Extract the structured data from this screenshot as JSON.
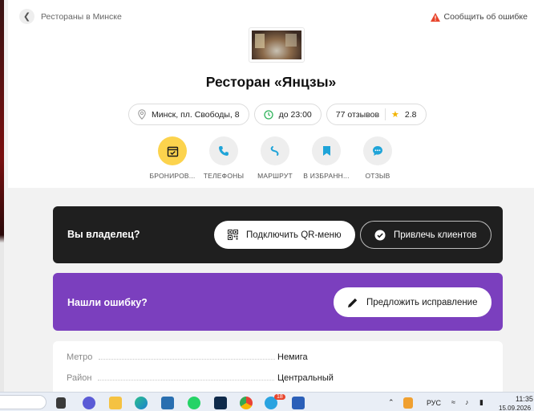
{
  "breadcrumb": {
    "label": "Рестораны в Минске"
  },
  "report": {
    "label": "Сообщить об ошибке"
  },
  "restaurant": {
    "title": "Ресторан «Янцзы»",
    "address": "Минск, пл. Свободы, 8",
    "hours": "до 23:00",
    "reviews": "77 отзывов",
    "rating": "2.8"
  },
  "actions": [
    {
      "label": "БРОНИРОВ...",
      "icon": "calendar-check-icon"
    },
    {
      "label": "ТЕЛЕФОНЫ",
      "icon": "phone-icon"
    },
    {
      "label": "МАРШРУТ",
      "icon": "route-icon"
    },
    {
      "label": "В ИЗБРАНН...",
      "icon": "bookmark-icon"
    },
    {
      "label": "ОТЗЫВ",
      "icon": "chat-icon"
    }
  ],
  "owner": {
    "title": "Вы владелец?",
    "qr_button": "Подключить QR-меню",
    "clients_button": "Привлечь клиентов"
  },
  "error": {
    "title": "Нашли ошибку?",
    "fix_button": "Предложить исправление"
  },
  "info": [
    {
      "key": "Метро",
      "value": "Немига"
    },
    {
      "key": "Район",
      "value": "Центральный"
    }
  ],
  "taskbar": {
    "lang": "РУС",
    "time": "11:35",
    "date": "15.09.2026",
    "telegram_badge": "18"
  },
  "colors": {
    "accent_yellow": "#fcd34d",
    "icon_blue": "#1fa4d8",
    "owner_bg": "#1f1f1f",
    "error_bg": "#7b3fbe",
    "warning_red": "#e8452c"
  }
}
